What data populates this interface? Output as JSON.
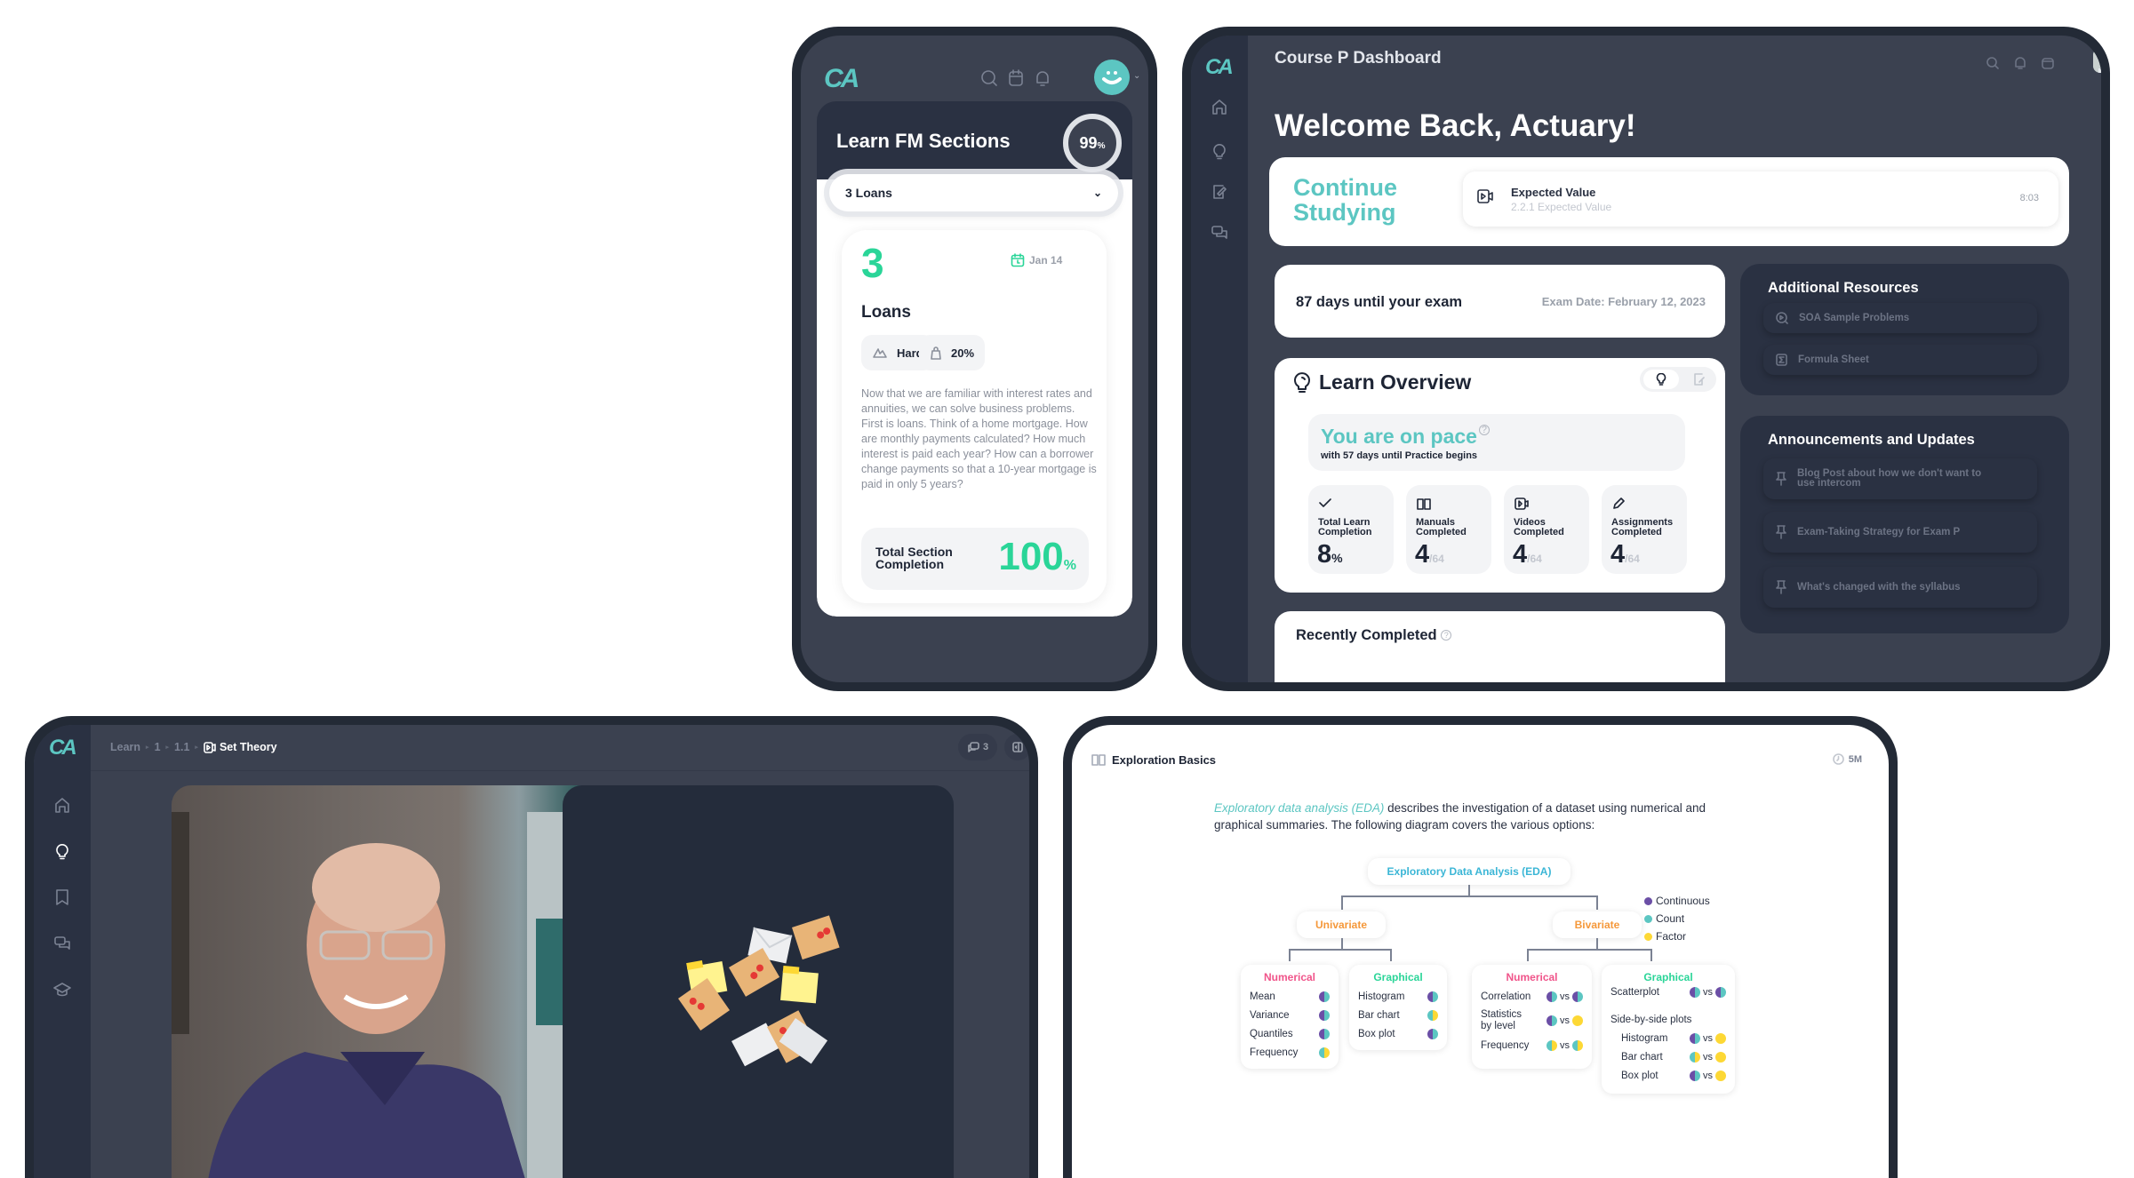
{
  "colors": {
    "brand_teal": "#5cc6c2",
    "green": "#2ad598",
    "pink": "#f0548a",
    "orange": "#f5983a",
    "continuous": "#6b4fa6",
    "count": "#5cc6c2",
    "factor": "#fdd835"
  },
  "phone": {
    "logo": "CA",
    "header_icons": [
      "search-icon",
      "calendar-icon",
      "bell-icon",
      "avatar-smiley"
    ],
    "title": "Learn FM Sections",
    "progress_percent": "99",
    "progress_suffix": "%",
    "section_select": "3 Loans",
    "card": {
      "number": "3",
      "date": "Jan 14",
      "name": "Loans",
      "difficulty": "Hard",
      "weight": "20%",
      "description": "Now that we are familiar with interest rates and annuities, we can solve business problems. First is loans. Think of a home mortgage. How are monthly payments calculated? How much interest is paid each year? How can a borrower change payments so that a 10-year mortgage is paid in only 5 years?",
      "total_label": "Total Section Completion",
      "total_value": "100",
      "total_suffix": "%"
    }
  },
  "dashboard": {
    "logo": "CA",
    "title": "Course P Dashboard",
    "welcome": "Welcome Back, Actuary!",
    "continue_label": "Continue Studying",
    "continue_item": {
      "title": "Expected Value",
      "subtitle": "2.2.1 Expected Value",
      "duration": "8:03"
    },
    "exam_countdown": "87 days until your exam",
    "exam_date": "Exam Date: February 12, 2023",
    "learn_overview": {
      "title": "Learn Overview",
      "pace_title": "You are on pace",
      "pace_help": "?",
      "pace_sub": "with 57 days until Practice begins",
      "stats": [
        {
          "label": "Total Learn Completion",
          "value": "8",
          "suffix": "%"
        },
        {
          "label": "Manuals Completed",
          "value": "4",
          "suffix": "/64"
        },
        {
          "label": "Videos Completed",
          "value": "4",
          "suffix": "/64"
        },
        {
          "label": "Assignments Completed",
          "value": "4",
          "suffix": "/64"
        }
      ]
    },
    "recently_completed": "Recently Completed",
    "resources": {
      "title": "Additional Resources",
      "items": [
        "SOA Sample Problems",
        "Formula Sheet"
      ]
    },
    "announcements": {
      "title": "Announcements and Updates",
      "items": [
        "Blog Post about how we don't want to use intercom",
        "Exam-Taking Strategy for Exam P",
        "What's changed with the syllabus"
      ]
    }
  },
  "video": {
    "logo": "CA",
    "breadcrumb": [
      "Learn",
      "1",
      "1.1"
    ],
    "current": "Set Theory",
    "comments_count": "3"
  },
  "eda": {
    "title": "Exploration Basics",
    "time": "5M",
    "intro_em": "Exploratory data analysis (EDA)",
    "intro_rest": " describes the investigation of a dataset using numerical and graphical summaries. The following diagram covers the various options:",
    "root": "Exploratory Data Analysis (EDA)",
    "univariate": "Univariate",
    "bivariate": "Bivariate",
    "legend": [
      "Continuous",
      "Count",
      "Factor"
    ],
    "uni_numerical": {
      "title": "Numerical",
      "rows": [
        "Mean",
        "Variance",
        "Quantiles",
        "Frequency"
      ]
    },
    "uni_graphical": {
      "title": "Graphical",
      "rows": [
        "Histogram",
        "Bar chart",
        "Box plot"
      ]
    },
    "bi_numerical": {
      "title": "Numerical",
      "rows": [
        "Correlation",
        "Statistics by level",
        "Frequency"
      ]
    },
    "bi_graphical": {
      "title": "Graphical",
      "rows": [
        "Scatterplot",
        "Side-by-side plots",
        "Histogram",
        "Bar chart",
        "Box plot"
      ]
    },
    "vs": "vs"
  }
}
